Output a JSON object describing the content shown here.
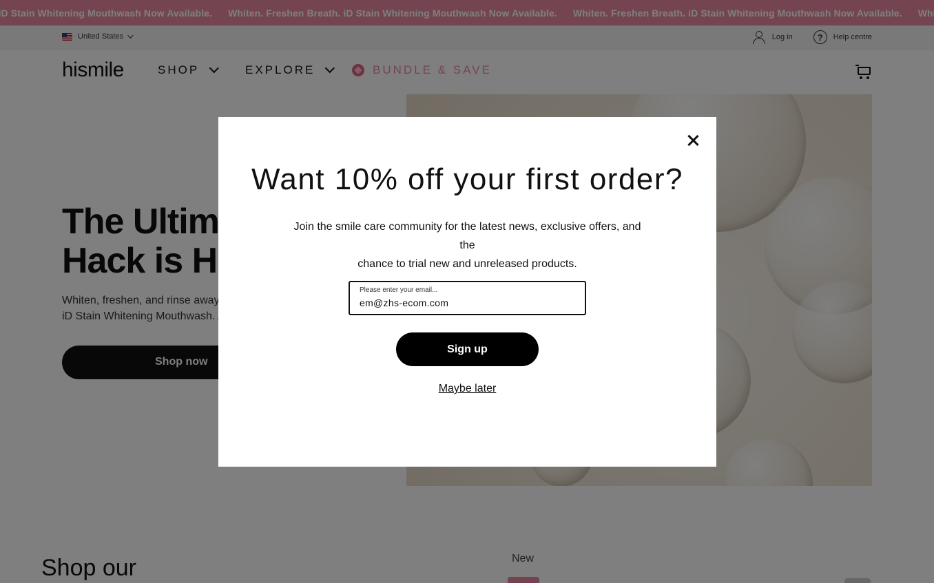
{
  "announcement": {
    "messages": [
      "n Breath. iD Stain Whitening Mouthwash Now Available.",
      "Whiten. Freshen Breath. iD Stain Whitening Mouthwash Now Available.",
      "Whiten. Freshen Breath. iD Stain Whitening Mouthwash Now Available.",
      "Whiten. Fresh"
    ]
  },
  "utility": {
    "region": "United States",
    "login": "Log in",
    "help": "Help centre"
  },
  "nav": {
    "logo": "hismile",
    "shop": "SHOP",
    "explore": "EXPLORE",
    "bundle": "BUNDLE & SAVE"
  },
  "hero": {
    "title_line1": "The Ultimate",
    "title_line2": "Hack is Here",
    "subtitle_line1": "Whiten, freshen, and rinse away g",
    "subtitle_line2": "iD Stain Whitening Mouthwash. A",
    "button": "Shop now"
  },
  "section": {
    "title": "Shop our",
    "badge": "New"
  },
  "modal": {
    "title": "Want 10% off your first order?",
    "text_line1": "Join the smile care community for the latest news, exclusive offers, and the",
    "text_line2": "chance to trial new and unreleased products.",
    "email_label": "Please enter your email...",
    "email_value": "em@zhs-ecom.com",
    "signup": "Sign up",
    "dismiss": "Maybe later"
  },
  "colors": {
    "accent_pink": "#e88aa2",
    "button_black": "#000000"
  }
}
